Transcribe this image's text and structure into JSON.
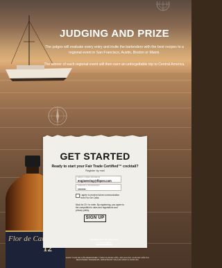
{
  "hero": {
    "title": "JUDGING AND PRIZE",
    "paragraph1": "The judges will evaluate every entry and invite the bartenders with the best recipes to a regional event in San Francisco, Austin, Boston or Miami.",
    "paragraph2": "The winner of each regional event will then earn an unforgettable trip to Central America."
  },
  "signup": {
    "title": "GET STARTED",
    "question": "Ready to start your Fair Trade Certified™ cocktail?",
    "subtext": "Register by mail",
    "email": {
      "label": "EMAIL/USER ADDRESS",
      "value": "engineering@flqser.com"
    },
    "password": {
      "label": "CREATE A PASSWORD",
      "value": "••••••••"
    },
    "consent_text": "I agree to receive future communication from Flor De Caña.",
    "legal_text": "Must be 21+ to enter. By registering, you agree to the competition's rules and regulations and privacy policy.",
    "signup_button": "SIGN UP"
  },
  "footer": {
    "already_text": "Already have an account?",
    "login_link": "LOGIN HERE",
    "legal": "ENJOY FLOR DE CAÑA RESPONSIBLY. ©2015 FLOR DE CAÑA, 40% ALC/VOL. FLOR DE CAÑA IS A REGISTERED TRADEMARK. IMPORTED BY WILLIAM GRANT & SONS INC."
  },
  "bottle": {
    "brand": "Flor de Caña",
    "age": "12"
  },
  "icons": {
    "compass_top": "compass-icon",
    "compass_mid": "compass-icon",
    "sailboat": "sailboat-icon"
  }
}
